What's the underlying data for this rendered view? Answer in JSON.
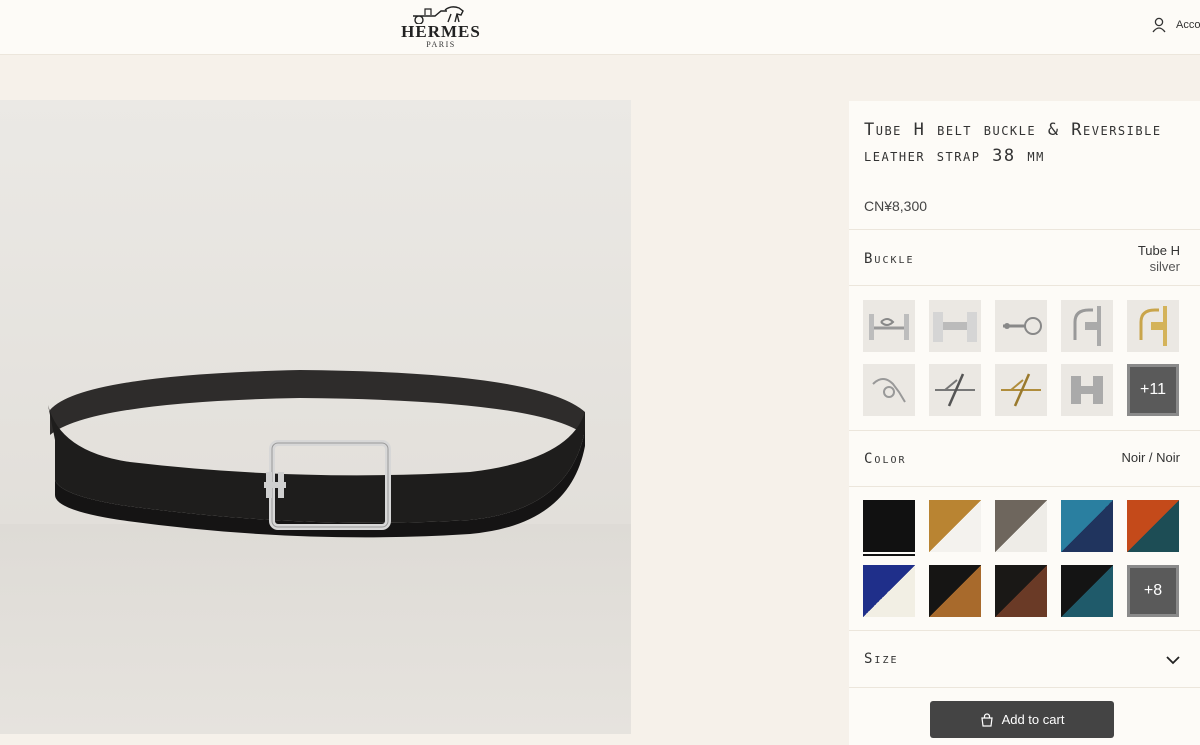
{
  "header": {
    "brand": "HERMES",
    "brand_sub": "PARIS",
    "account_label": "Acco"
  },
  "product": {
    "title": "Tube H belt buckle & Reversible leather strap 38 mm",
    "price": "CN¥8,300"
  },
  "buckle": {
    "label": "Buckle",
    "selected_name": "Tube H",
    "selected_finish": "silver",
    "more_label": "+11"
  },
  "color": {
    "label": "Color",
    "selected": "Noir / Noir",
    "more_label": "+8"
  },
  "size": {
    "label": "Size"
  },
  "cart": {
    "label": "Add to cart"
  },
  "colors": {
    "background": "#f6f1ea",
    "panel": "#fdfbf7",
    "cart_button": "#444444",
    "swatch_noir": "#111111",
    "swatch_gold": "#b98432",
    "swatch_etoupe": "#6e665d",
    "swatch_blue": "#2a7fa0",
    "swatch_orange": "#c44a1a",
    "swatch_navy": "#1f2f8a"
  }
}
